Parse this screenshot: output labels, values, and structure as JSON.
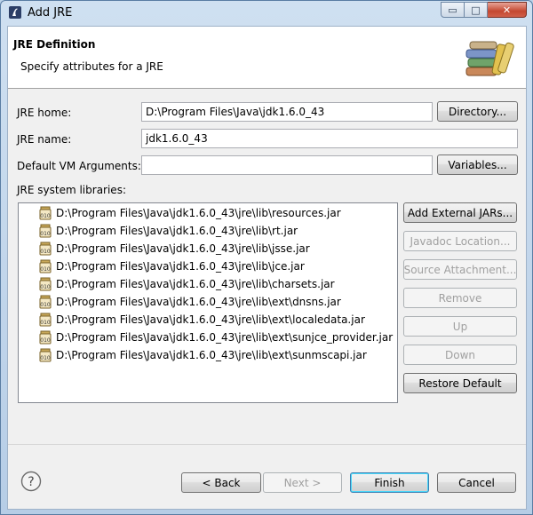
{
  "window": {
    "title": "Add JRE",
    "controls": {
      "minimize": "▭",
      "maximize": "□",
      "close": "✕"
    }
  },
  "header": {
    "title": "JRE Definition",
    "description": "Specify attributes for a JRE",
    "icon": "java-libraries-icon"
  },
  "form": {
    "jre_home_label": "JRE home:",
    "jre_home_value": "D:\\Program Files\\Java\\jdk1.6.0_43",
    "directory_button": "Directory...",
    "jre_name_label": "JRE name:",
    "jre_name_value": "jdk1.6.0_43",
    "vm_args_label": "Default VM Arguments:",
    "vm_args_value": "",
    "variables_button": "Variables...",
    "libraries_label": "JRE system libraries:"
  },
  "libraries": [
    {
      "path": "D:\\Program Files\\Java\\jdk1.6.0_43\\jre\\lib\\resources.jar",
      "icon": "jar-icon"
    },
    {
      "path": "D:\\Program Files\\Java\\jdk1.6.0_43\\jre\\lib\\rt.jar",
      "icon": "jar-icon"
    },
    {
      "path": "D:\\Program Files\\Java\\jdk1.6.0_43\\jre\\lib\\jsse.jar",
      "icon": "jar-icon"
    },
    {
      "path": "D:\\Program Files\\Java\\jdk1.6.0_43\\jre\\lib\\jce.jar",
      "icon": "jar-icon"
    },
    {
      "path": "D:\\Program Files\\Java\\jdk1.6.0_43\\jre\\lib\\charsets.jar",
      "icon": "jar-icon"
    },
    {
      "path": "D:\\Program Files\\Java\\jdk1.6.0_43\\jre\\lib\\ext\\dnsns.jar",
      "icon": "jar-icon"
    },
    {
      "path": "D:\\Program Files\\Java\\jdk1.6.0_43\\jre\\lib\\ext\\localedata.jar",
      "icon": "jar-icon"
    },
    {
      "path": "D:\\Program Files\\Java\\jdk1.6.0_43\\jre\\lib\\ext\\sunjce_provider.jar",
      "icon": "jar-icon"
    },
    {
      "path": "D:\\Program Files\\Java\\jdk1.6.0_43\\jre\\lib\\ext\\sunmscapi.jar",
      "icon": "jar-icon"
    }
  ],
  "library_buttons": {
    "add_external_jars": "Add External JARs...",
    "javadoc_location": "Javadoc Location...",
    "source_attachment": "Source Attachment...",
    "remove": "Remove",
    "up": "Up",
    "down": "Down",
    "restore_default": "Restore Default"
  },
  "footer": {
    "help_icon": "?",
    "back": "< Back",
    "next": "Next >",
    "finish": "Finish",
    "cancel": "Cancel"
  },
  "colors": {
    "title_bar": "#bcd3ea",
    "dialog_bg": "#f0f0f0",
    "header_bg": "#ffffff",
    "default_button_border": "#3c7fb1"
  }
}
